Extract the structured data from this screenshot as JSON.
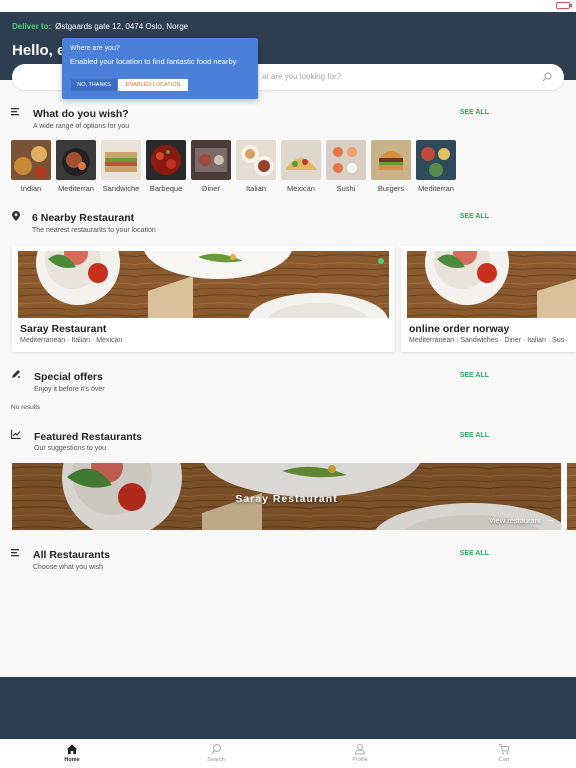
{
  "header": {
    "deliver_label": "Deliver to:",
    "address": "Østgaards gate 12, 0474 Oslo, Norge",
    "greeting": "Hello, el"
  },
  "search": {
    "placeholder": "at are you looking for?",
    "icon": "search-icon"
  },
  "location_popup": {
    "title": "Where are you?",
    "message": "Enabled your location to find fantastic food nearby",
    "no_label": "NO, THANKS",
    "enable_label": "ENABLED LOCATION"
  },
  "sections": {
    "wish": {
      "title": "What do you wish?",
      "subtitle": "A wide range of options for you",
      "see_all": "SEE ALL",
      "icon": "list-icon"
    },
    "nearby": {
      "title": "6 Nearby Restaurant",
      "subtitle": "The nearest restaurants to your location",
      "see_all": "SEE ALL",
      "icon": "location-pin-icon"
    },
    "offers": {
      "title": "Special offers",
      "subtitle": "Enjoy it before it's over",
      "see_all": "SEE ALL",
      "empty": "No results",
      "icon": "pencil-icon"
    },
    "featured": {
      "title": "Featured Restaurants",
      "subtitle": "Our suggestions to you",
      "see_all": "SEE ALL",
      "icon": "trend-chart-icon"
    },
    "all": {
      "title": "All Restaurants",
      "subtitle": "Choose what you wish",
      "see_all": "SEE ALL",
      "icon": "list-icon"
    }
  },
  "categories": [
    "Indian",
    "Mediterran",
    "Sandwiche",
    "Barbeque",
    "Diner",
    "Italian",
    "Mexican",
    "Sushi",
    "Burgers",
    "Mediterran"
  ],
  "nearby_restaurants": [
    {
      "name": "Saray Restaurant",
      "cuisines": "Mediterranean · Italian · Mexican",
      "open": true
    },
    {
      "name": "online order norway",
      "cuisines": "Mediterranean · Sandwiches · Diner · Italian · Sus"
    }
  ],
  "featured": {
    "name": "Saray Restaurant",
    "view_label": "View restaurant",
    "arrow": "→"
  },
  "tabs": [
    {
      "label": "Home",
      "icon": "home-icon",
      "active": true
    },
    {
      "label": "Search",
      "icon": "search-icon"
    },
    {
      "label": "Profile",
      "icon": "profile-icon"
    },
    {
      "label": "Cart",
      "icon": "cart-icon"
    }
  ],
  "colors": {
    "header": "#2c3e50",
    "accent": "#2ea85a",
    "popup": "#4a80d8",
    "enable_text": "#e07a30"
  }
}
